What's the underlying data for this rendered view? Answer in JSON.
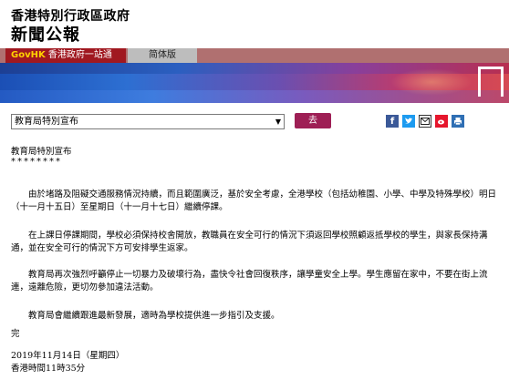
{
  "header": {
    "gov_name": "香港特別行政區政府",
    "site_name": "新聞公報"
  },
  "tabs": {
    "govhk_mark": "GovHK",
    "govhk_label": "香港政府一站通",
    "simplified_label": "简体版"
  },
  "toolbar": {
    "category_select_value": "教育局特別宣布",
    "go_label": "去"
  },
  "share_icons": [
    "facebook-icon",
    "twitter-icon",
    "email-icon",
    "weibo-icon",
    "print-icon"
  ],
  "colors": {
    "go_button": "#9e1f55",
    "govhk_tab": "#a01820",
    "tabbar": "#b07070"
  },
  "article": {
    "title": "教育局特別宣布",
    "stars": "********",
    "paragraphs": [
      "由於堵路及阻礙交通服務情況持續，而且範圍廣泛，基於安全考慮，全港學校（包括幼稚園、小學、中學及特殊學校）明日（十一月十五日）至星期日（十一月十七日）繼續停課。",
      "在上課日停課期間，學校必須保持校舍開放，教職員在安全可行的情況下須返回學校照顧返抵學校的學生，與家長保持溝通，並在安全可行的情況下方可安排學生返家。",
      "教育局再次強烈呼籲停止一切暴力及破壞行為，盡快令社會回復秩序，讓學童安全上學。學生應留在家中，不要在街上流連，遠離危險，更切勿參加違法活動。",
      "教育局會繼續跟進最新發展，適時為學校提供進一步指引及支援。"
    ],
    "end_mark": "完",
    "date": "2019年11月14日（星期四）",
    "time": "香港時間11時35分"
  }
}
